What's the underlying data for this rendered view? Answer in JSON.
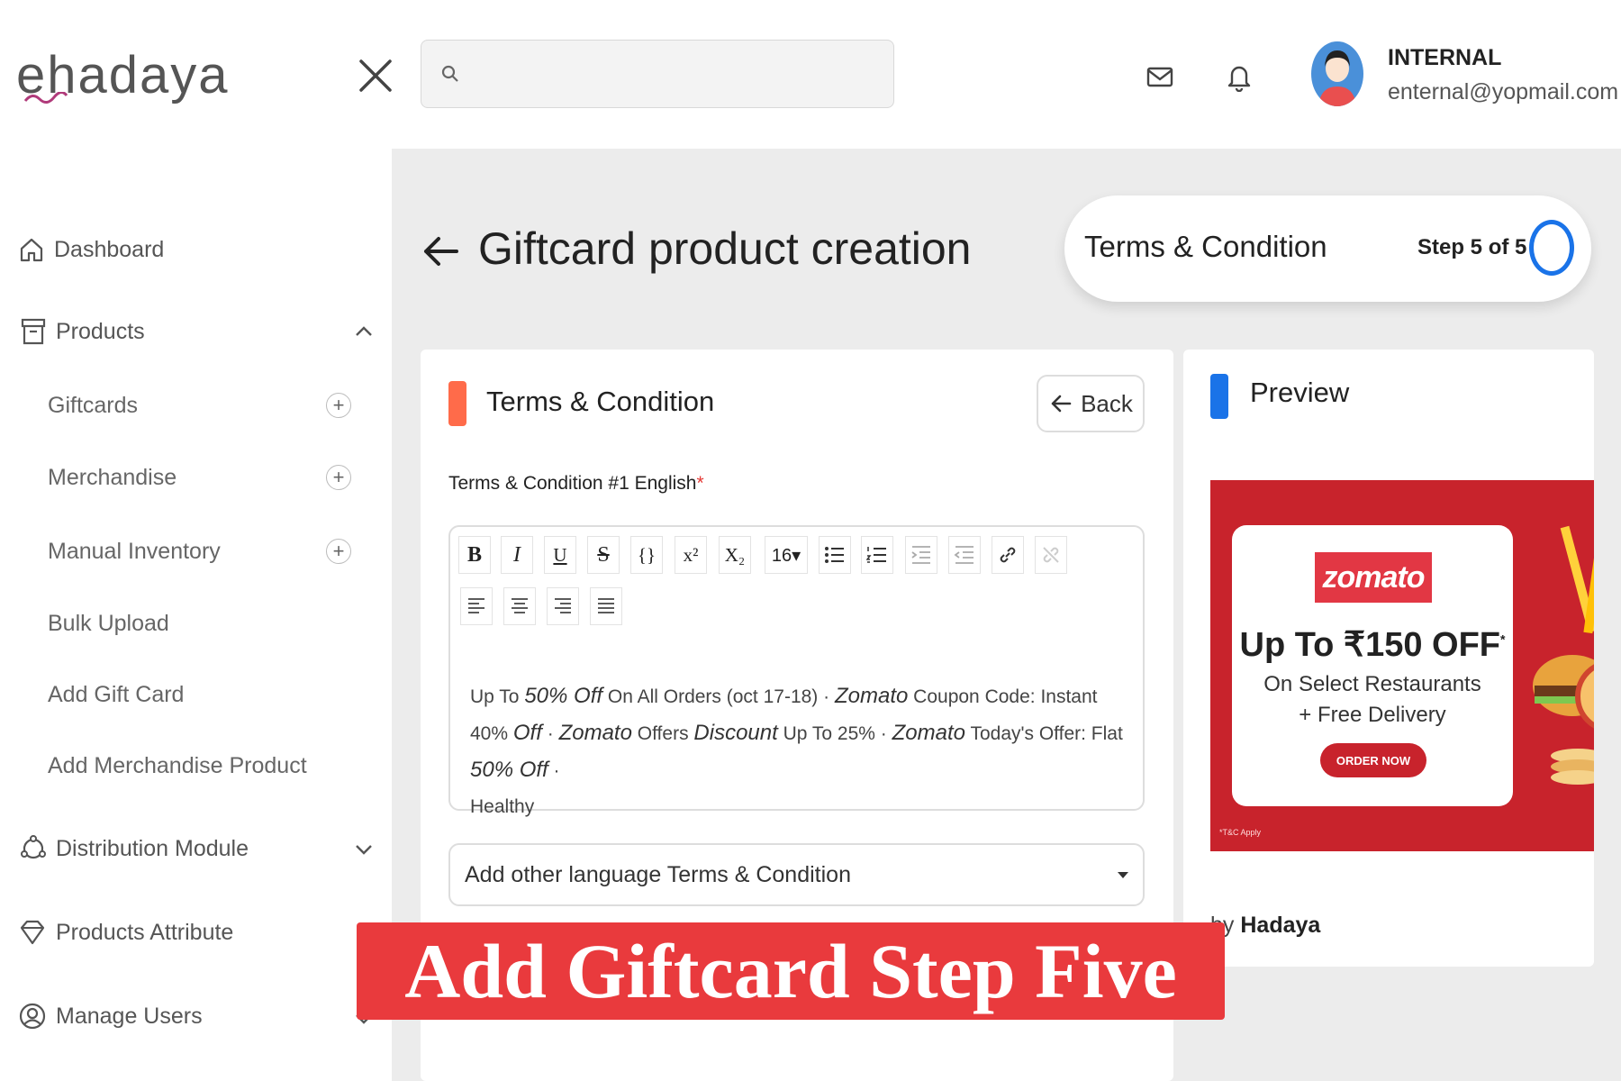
{
  "header": {
    "logo_text": "ehadaya",
    "search_placeholder": "",
    "user": {
      "name": "INTERNAL",
      "email": "enternal@yopmail.com"
    }
  },
  "sidebar": {
    "dashboard": "Dashboard",
    "products": "Products",
    "product_items": [
      {
        "label": "Giftcards",
        "plus": "+"
      },
      {
        "label": "Merchandise",
        "plus": "+"
      },
      {
        "label": "Manual Inventory",
        "plus": "+"
      },
      {
        "label": "Bulk Upload"
      },
      {
        "label": "Add Gift Card"
      },
      {
        "label": "Add Merchandise Product"
      }
    ],
    "distribution": "Distribution Module",
    "attribute": "Products Attribute",
    "users": "Manage Users"
  },
  "main": {
    "page_title": "Giftcard product creation",
    "step": {
      "label": "Terms & Condition",
      "count": "Step 5 of 5"
    },
    "terms_card": {
      "title": "Terms & Condition",
      "back_label": "Back",
      "field_label": "Terms & Condition #1 English",
      "required_mark": "*",
      "toolbar": {
        "bold": "B",
        "italic": "I",
        "underline": "U",
        "strike": "S",
        "code": "{}",
        "sup": "x²",
        "sub": "X₂",
        "font_size": "16▾"
      },
      "content": {
        "p1": "Up To ",
        "i1": "50% Off",
        "p2": " On All Orders (oct 17-18) · ",
        "i2": "Zomato",
        "p3": " Coupon Code: Instant 40% ",
        "i3": "Off",
        "p4": " · ",
        "i4": "Zomato",
        "p5": " Offers ",
        "i5": "Discount",
        "p6": " Up To 25% · ",
        "i6": "Zomato",
        "p7": " Today's Offer: Flat ",
        "i7": "50% Off",
        "p8": " · ",
        "p9": "Healthy"
      },
      "language_select": "Add other language Terms & Condition"
    },
    "preview": {
      "title": "Preview",
      "banner": {
        "brand": "zomato",
        "offer": "Up To ₹150 OFF",
        "offer_mark": "*",
        "sub1": "On Select Restaurants",
        "sub2": "+ Free Delivery",
        "cta": "ORDER NOW",
        "fineprint": "*T&C Apply"
      },
      "by_prefix": "by ",
      "by_brand": "Hadaya"
    }
  },
  "overlay_caption": "Add Giftcard Step Five",
  "colors": {
    "accent_blue": "#1a73e8",
    "accent_orange": "#ff6b4a",
    "banner_red": "#c8232c",
    "caption_red": "#e93a3d"
  }
}
